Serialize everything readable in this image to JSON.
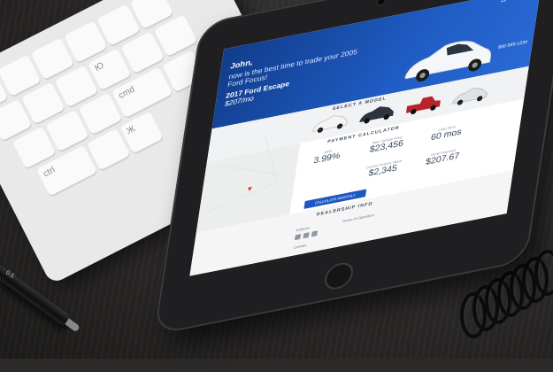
{
  "keyboard": {
    "keys": [
      "",
      "",
      "",
      "",
      "",
      "",
      "",
      "",
      "",
      "Ю",
      "",
      "",
      "",
      "",
      "",
      "cmd",
      "",
      "ctrl",
      "",
      "Ж"
    ]
  },
  "pen": {
    "mark": "0.5"
  },
  "screen": {
    "header": {
      "greeting": "John,",
      "message": "now is the best time to trade your 2005 Ford Focus!",
      "car": "2017 Ford Escape",
      "price": "$207/mo",
      "phone": "800-555-1234"
    },
    "models": {
      "title": "SELECT A MODEL"
    },
    "calculator": {
      "title": "PAYMENT CALCULATOR",
      "cells": [
        {
          "label": "APR",
          "value": "3.99%"
        },
        {
          "label": "New Vehicle Price",
          "value": "$23,456"
        },
        {
          "label": "Loan Term",
          "value": "60 mos"
        },
        {
          "label": "Current Vehicle Value",
          "value": "$2,345"
        },
        {
          "label": "Down Payment",
          "value": "$207.67"
        }
      ],
      "button": "CALCULATE MONTHLY PAYMENTS"
    },
    "dealership": {
      "title": "DEALERSHIP INFO",
      "address_label": "Address",
      "hours_label": "Hours of Operation",
      "contact_label": "Contact"
    }
  },
  "colors": {
    "header_blue": "#1f5cc4",
    "button_blue": "#1d57c0",
    "tablet_bezel": "#1f1f21",
    "desk": "#2b2a29",
    "keyboard": "#e9e9ea",
    "map_pin": "#d43a2b"
  }
}
